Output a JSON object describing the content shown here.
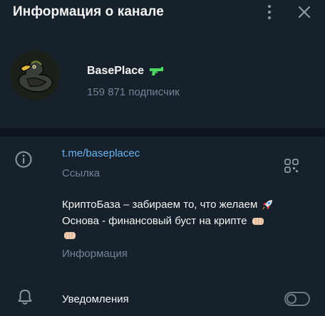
{
  "header": {
    "title": "Информация о канале",
    "menu_icon": "more-vertical-icon",
    "close_icon": "close-icon"
  },
  "channel": {
    "name": "BasePlace",
    "name_emoji": "water-pistol-emoji",
    "subscribers": "159 871 подписчик",
    "avatar": "duck-logo-avatar"
  },
  "link_section": {
    "url": "t.me/baseplacec",
    "caption": "Ссылка",
    "icon": "info-icon",
    "qr_icon": "qr-code-icon"
  },
  "description": {
    "line1": "КриптоБаза – забираем то, что желаем",
    "line1_emoji": "rocket-emoji",
    "line2": "Основа - финансовый буст на крипте",
    "line2_emoji": "fist-right-emoji",
    "line3_emoji": "fist-left-emoji",
    "caption": "Информация"
  },
  "notifications": {
    "label": "Уведомления",
    "icon": "bell-icon",
    "enabled": false
  },
  "colors": {
    "background": "#17212b",
    "divider": "#0e1621",
    "accent_link": "#6ab3f3",
    "secondary_text": "#708499",
    "icon_gray": "#8b98a5"
  }
}
